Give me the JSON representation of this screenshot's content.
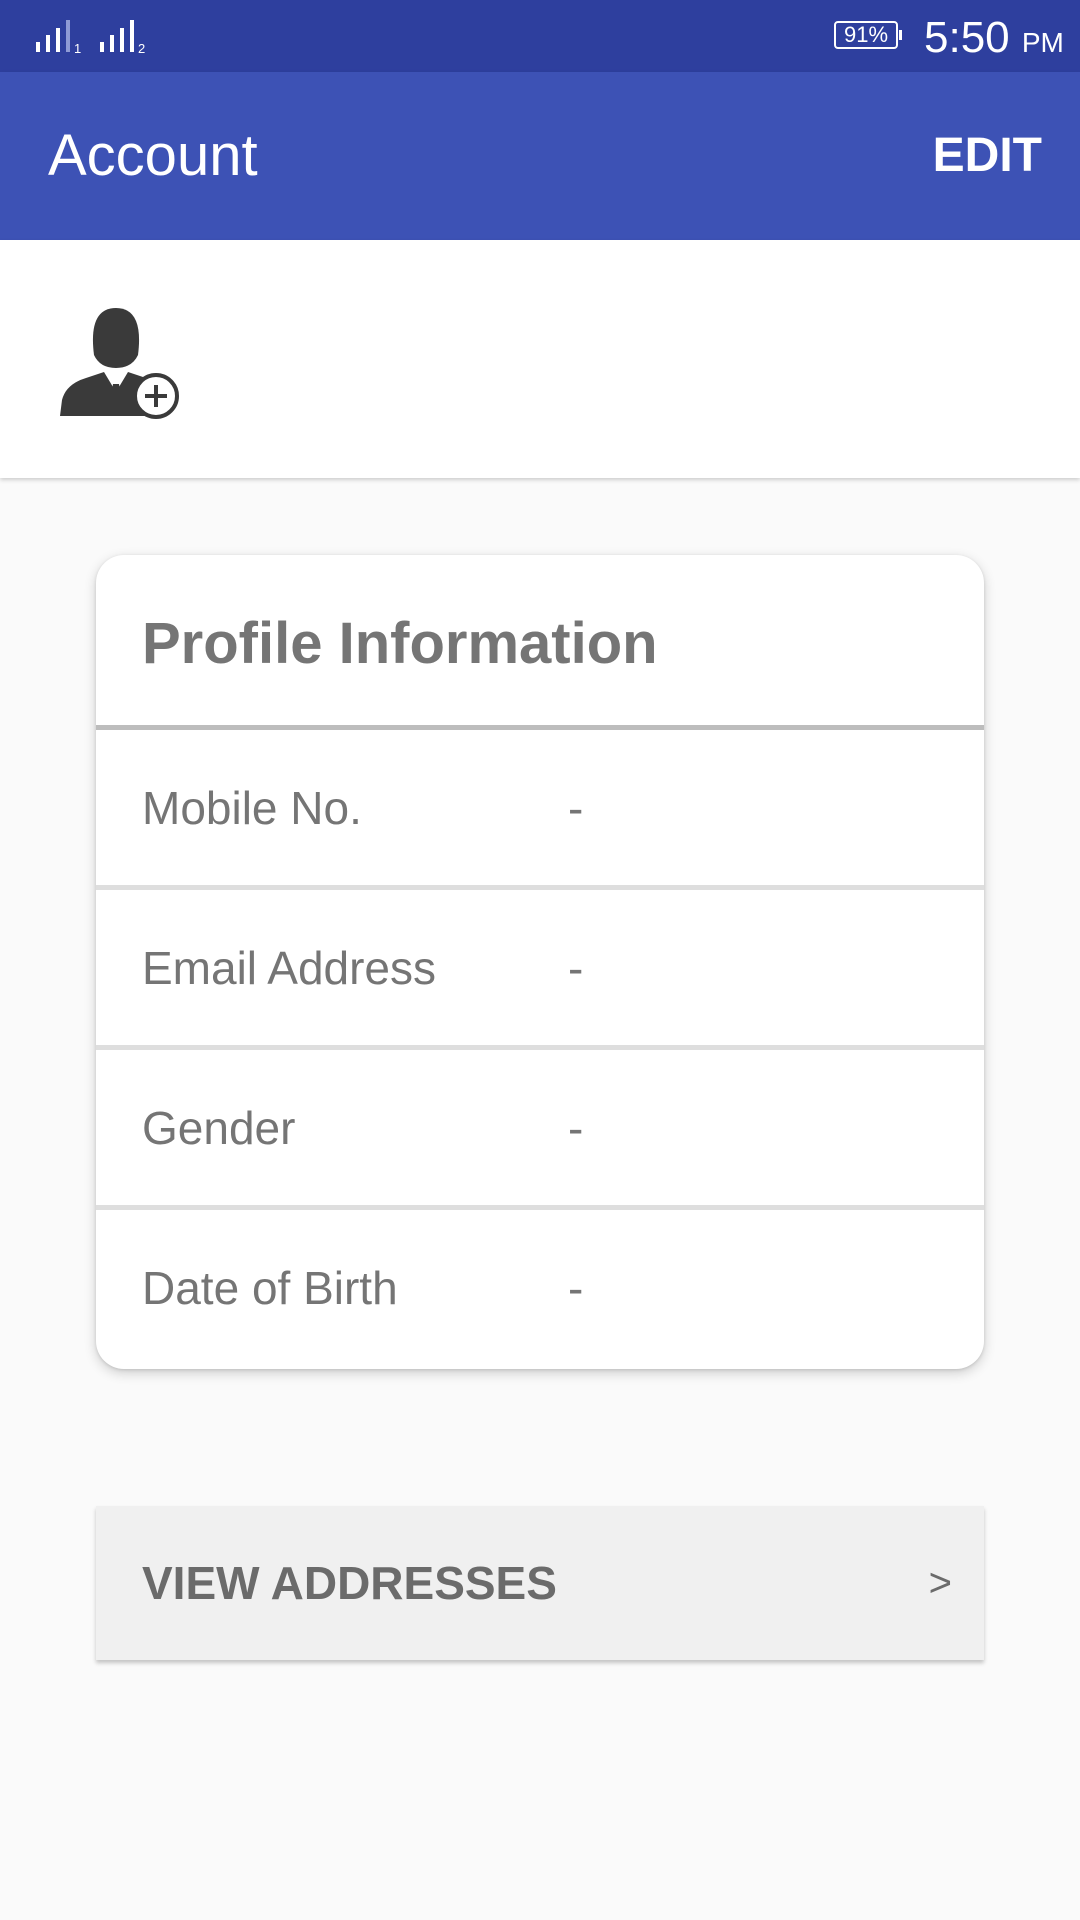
{
  "status_bar": {
    "sim1_label": "1",
    "sim2_label": "2",
    "battery": "91%",
    "time": "5:50",
    "ampm": "PM"
  },
  "app_bar": {
    "title": "Account",
    "edit_label": "EDIT"
  },
  "avatar": {
    "icon": "add-user-avatar-icon"
  },
  "profile_card": {
    "title": "Profile Information",
    "rows": [
      {
        "label": "Mobile No.",
        "value": "-"
      },
      {
        "label": "Email Address",
        "value": "-"
      },
      {
        "label": "Gender",
        "value": "-"
      },
      {
        "label": "Date of Birth",
        "value": "-"
      }
    ]
  },
  "addresses_button": {
    "label": "VIEW ADDRESSES",
    "chevron": ">"
  },
  "colors": {
    "status_bar": "#2e3f9e",
    "app_bar": "#3d52b5",
    "background": "#fafafa",
    "text_gray": "#757575"
  }
}
